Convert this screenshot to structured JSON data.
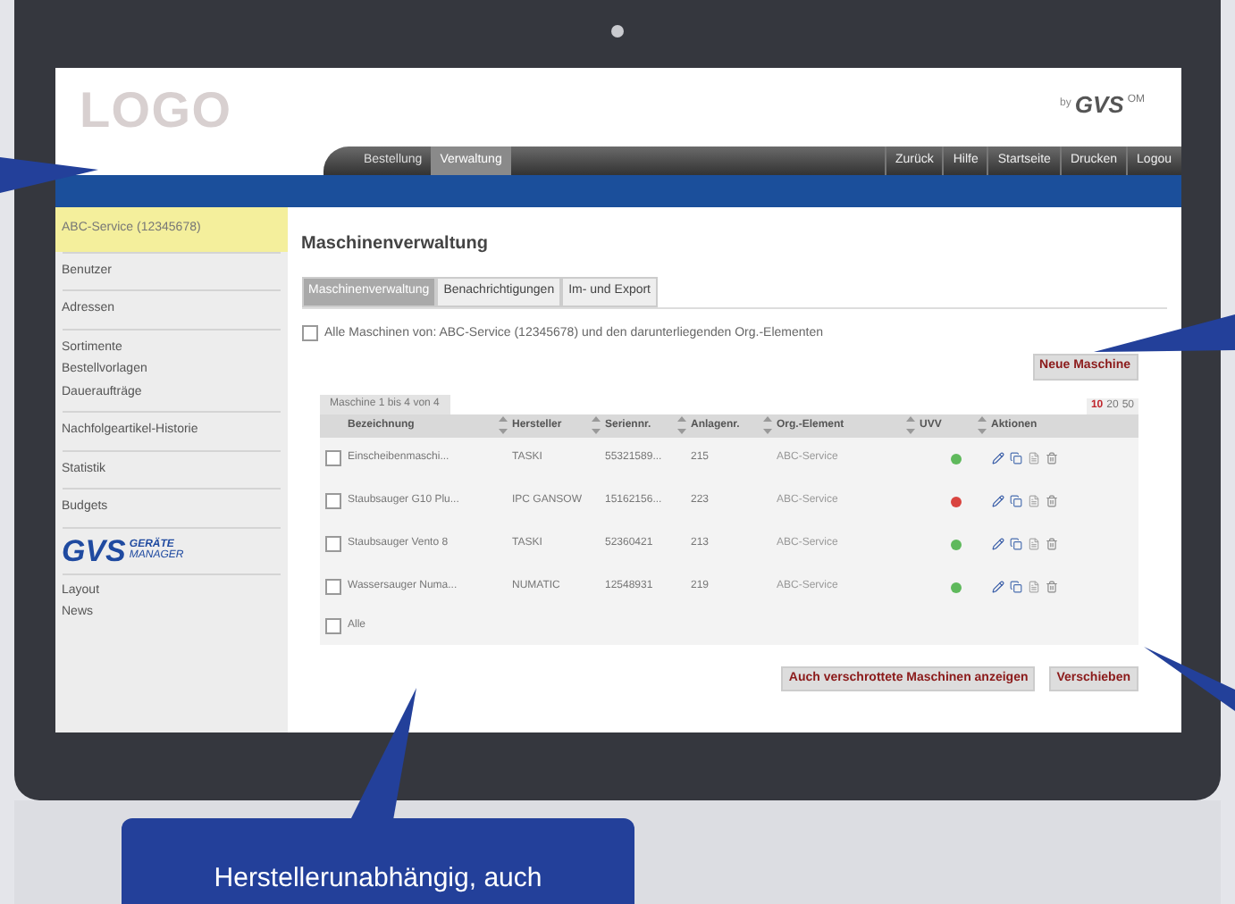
{
  "header": {
    "logo": "LOGO",
    "brand_by": "by",
    "brand_name": "GVS",
    "brand_suffix": "OM"
  },
  "nav_tabs": [
    {
      "label": "Bestellung",
      "selected": false
    },
    {
      "label": "Verwaltung",
      "selected": true
    }
  ],
  "nav_links": [
    "Zurück",
    "Hilfe",
    "Startseite",
    "Drucken",
    "Logou"
  ],
  "sidebar": {
    "account": "ABC-Service (12345678)",
    "groups": [
      [
        "Benutzer"
      ],
      [
        "Adressen"
      ],
      [
        "Sortimente",
        "Bestellvorlagen",
        "Daueraufträge"
      ],
      [
        "Nachfolgeartikel-Historie"
      ],
      [
        "Statistik"
      ],
      [
        "Budgets"
      ]
    ],
    "product_logo": {
      "name": "GVS",
      "line1": "GERÄTE",
      "line2": "MANAGER"
    },
    "footer_items": [
      "Layout",
      "News"
    ]
  },
  "page_title": "Maschinenverwaltung",
  "tabs": [
    {
      "label": "Maschinenverwaltung",
      "selected": true
    },
    {
      "label": "Benachrichtigungen",
      "selected": false
    },
    {
      "label": "Im- und Export",
      "selected": false
    }
  ],
  "filter": {
    "checked": false,
    "text": "Alle Maschinen von: ABC-Service (12345678) und den darunterliegenden Org.-Elementen"
  },
  "new_button": "Neue Maschine",
  "pager": "Maschine 1 bis 4 von 4",
  "page_sizes": [
    {
      "label": "10",
      "selected": true
    },
    {
      "label": "20",
      "selected": false
    },
    {
      "label": "50",
      "selected": false
    }
  ],
  "table": {
    "columns": [
      "Bezeichnung",
      "Hersteller",
      "Seriennr.",
      "Anlagenr.",
      "Org.-Element",
      "UVV",
      "Aktionen"
    ],
    "rows": [
      {
        "checked": false,
        "cells": [
          "Einscheibenmaschi...",
          "TASKI",
          "55321589...",
          "215",
          "ABC-Service"
        ],
        "uvv_ok": true
      },
      {
        "checked": false,
        "cells": [
          "Staubsauger G10 Plu...",
          "IPC GANSOW",
          "15162156...",
          "223",
          "ABC-Service"
        ],
        "uvv_ok": false
      },
      {
        "checked": false,
        "cells": [
          "Staubsauger Vento 8",
          "TASKI",
          "52360421",
          "213",
          "ABC-Service"
        ],
        "uvv_ok": true
      },
      {
        "checked": false,
        "cells": [
          "Wassersauger Numa...",
          "NUMATIC",
          "12548931",
          "219",
          "ABC-Service"
        ],
        "uvv_ok": true
      }
    ],
    "select_all": {
      "label": "Alle",
      "checked": false
    }
  },
  "buttons": [
    "Auch verschrottete Maschinen anzeigen",
    "Verschieben"
  ],
  "callout": "Herstellerunabhängig, auch"
}
